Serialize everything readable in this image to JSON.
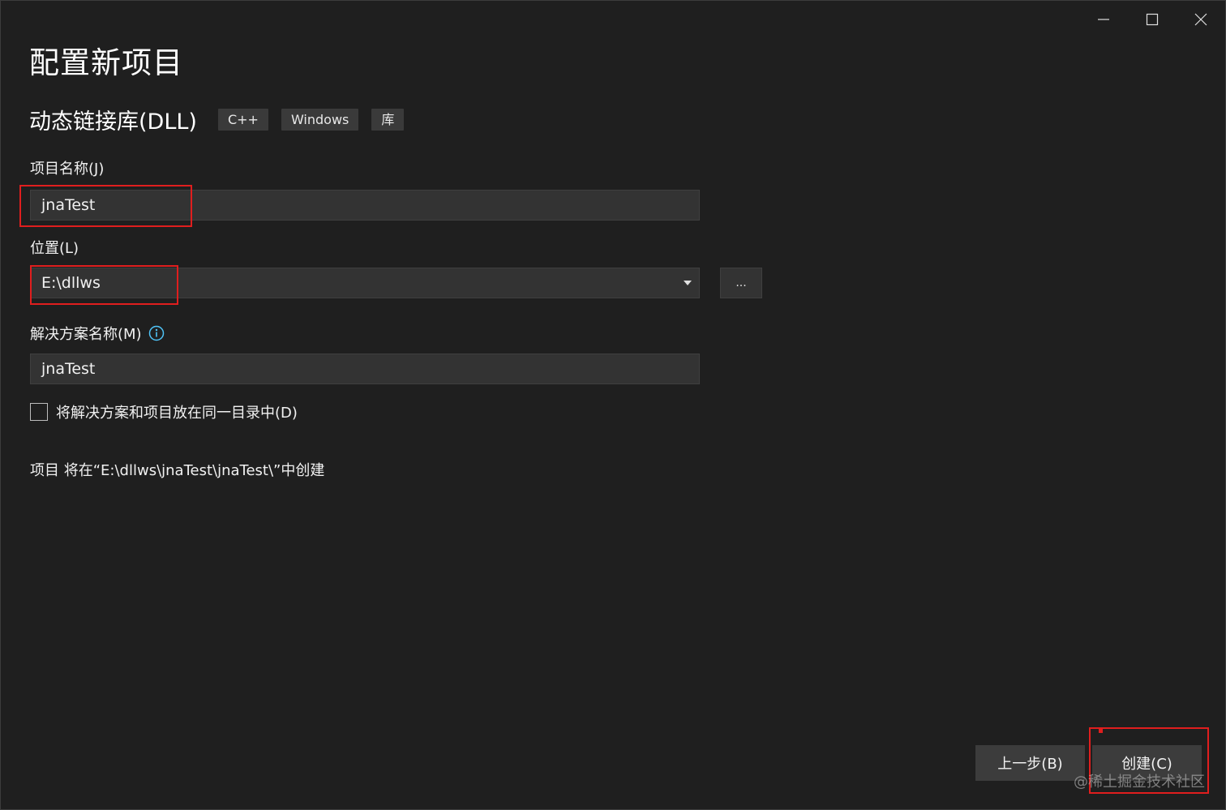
{
  "window": {
    "title": "配置新项目"
  },
  "template": {
    "name": "动态链接库(DLL)",
    "tags": [
      "C++",
      "Windows",
      "库"
    ]
  },
  "form": {
    "project_name_label": "项目名称(J)",
    "project_name_value": "jnaTest",
    "location_label": "位置(L)",
    "location_value": "E:\\dllws",
    "browse_label": "...",
    "solution_name_label": "解决方案名称(M)",
    "solution_name_value": "jnaTest",
    "same_dir_checkbox_label": "将解决方案和项目放在同一目录中(D)",
    "same_dir_checked": false,
    "path_info": "项目 将在“E:\\dllws\\jnaTest\\jnaTest\\”中创建"
  },
  "footer": {
    "back_label": "上一步(B)",
    "create_label": "创建(C)"
  },
  "watermark": "@稀土掘金技术社区",
  "colors": {
    "background": "#1f1f1f",
    "input_bg": "#333333",
    "highlight": "#e01e1e",
    "info_icon": "#4fc3f7"
  },
  "icons": {
    "minimize": "minimize-icon",
    "maximize": "maximize-icon",
    "close": "close-icon",
    "info": "info-icon",
    "dropdown": "chevron-down-icon"
  }
}
